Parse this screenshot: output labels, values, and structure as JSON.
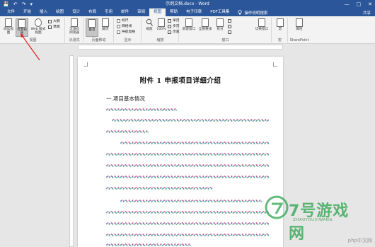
{
  "window": {
    "title": "示例文档.docx - Word",
    "qat": [
      "💾",
      "↶",
      "↷",
      "▾"
    ],
    "controls": [
      "—",
      "□",
      "✕"
    ]
  },
  "tabs": [
    {
      "label": "文件",
      "active": false
    },
    {
      "label": "开始",
      "active": false
    },
    {
      "label": "插入",
      "active": false
    },
    {
      "label": "绘图",
      "active": false
    },
    {
      "label": "设计",
      "active": false
    },
    {
      "label": "布局",
      "active": false
    },
    {
      "label": "引用",
      "active": false
    },
    {
      "label": "邮件",
      "active": false
    },
    {
      "label": "审阅",
      "active": false
    },
    {
      "label": "视图",
      "active": true
    },
    {
      "label": "帮助",
      "active": false
    },
    {
      "label": "电子印章",
      "active": false
    },
    {
      "label": "PDF工具集",
      "active": false
    }
  ],
  "tell_me": "操作说明搜索",
  "share": "共享",
  "ribbon": {
    "views": {
      "read_mode": "阅读视图",
      "print_layout": "页面视图",
      "web_layout": "Web 版式视图",
      "outline": "大纲",
      "draft": "草稿",
      "group_label": "视图"
    },
    "immersive": {
      "reader": "沉浸式阅读器",
      "group_label": "沉浸式"
    },
    "page_movement": {
      "vertical": "垂直",
      "side_to_side": "翻页",
      "group_label": "页面移动"
    },
    "show": {
      "ruler": "标尺",
      "gridlines": "网格线",
      "nav_pane": "导航窗格",
      "group_label": "显示"
    },
    "zoom": {
      "zoom": "缩放",
      "percent": "100%",
      "one_page": "单页",
      "multi_page": "多页",
      "page_width": "页宽",
      "group_label": "缩放"
    },
    "window": {
      "new_window": "新建窗口",
      "arrange_all": "全部重排",
      "split": "拆分",
      "switch_windows": "切换窗口",
      "group_label": "窗口"
    },
    "macros": {
      "label": "宏",
      "group_label": "宏"
    },
    "sharepoint": {
      "properties": "属性",
      "group_label": "SharePoint"
    }
  },
  "document": {
    "title": "附件 1    申报项目详细介绍",
    "heading": "一.项目基本情况"
  },
  "watermark": {
    "text": "7号游戏网",
    "sub": "ZHAOYOUXIWANG"
  },
  "corner_mark": "php中文网"
}
